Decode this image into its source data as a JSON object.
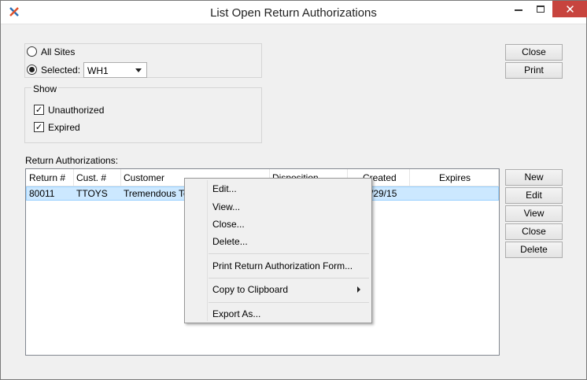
{
  "window": {
    "title": "List Open Return Authorizations",
    "close_glyph": "✕"
  },
  "sites": {
    "all_sites_label": "All Sites",
    "selected_label": "Selected:",
    "selected_value": "WH1",
    "selected_checked": true
  },
  "show": {
    "title": "Show",
    "unauthorized_label": "Unauthorized",
    "unauthorized_checked": true,
    "expired_label": "Expired",
    "expired_checked": true,
    "check_glyph": "✓"
  },
  "actions": {
    "close_label": "Close",
    "print_label": "Print"
  },
  "list": {
    "title": "Return Authorizations:",
    "columns": [
      "Return #",
      "Cust. #",
      "Customer",
      "Disposition",
      "Created",
      "Expires"
    ],
    "rows": [
      {
        "return_no": "80011",
        "cust_no": "TTOYS",
        "customer": "Tremendous To",
        "disposition": "",
        "created": "/29/15",
        "expires": ""
      }
    ]
  },
  "side_buttons": {
    "new_label": "New",
    "edit_label": "Edit",
    "view_label": "View",
    "close_label": "Close",
    "delete_label": "Delete"
  },
  "context_menu": {
    "edit": "Edit...",
    "view": "View...",
    "close": "Close...",
    "delete": "Delete...",
    "print_form": "Print Return Authorization Form...",
    "copy": "Copy to Clipboard",
    "export": "Export As..."
  },
  "colors": {
    "selection": "#cce8ff",
    "close_button": "#c7443e"
  }
}
